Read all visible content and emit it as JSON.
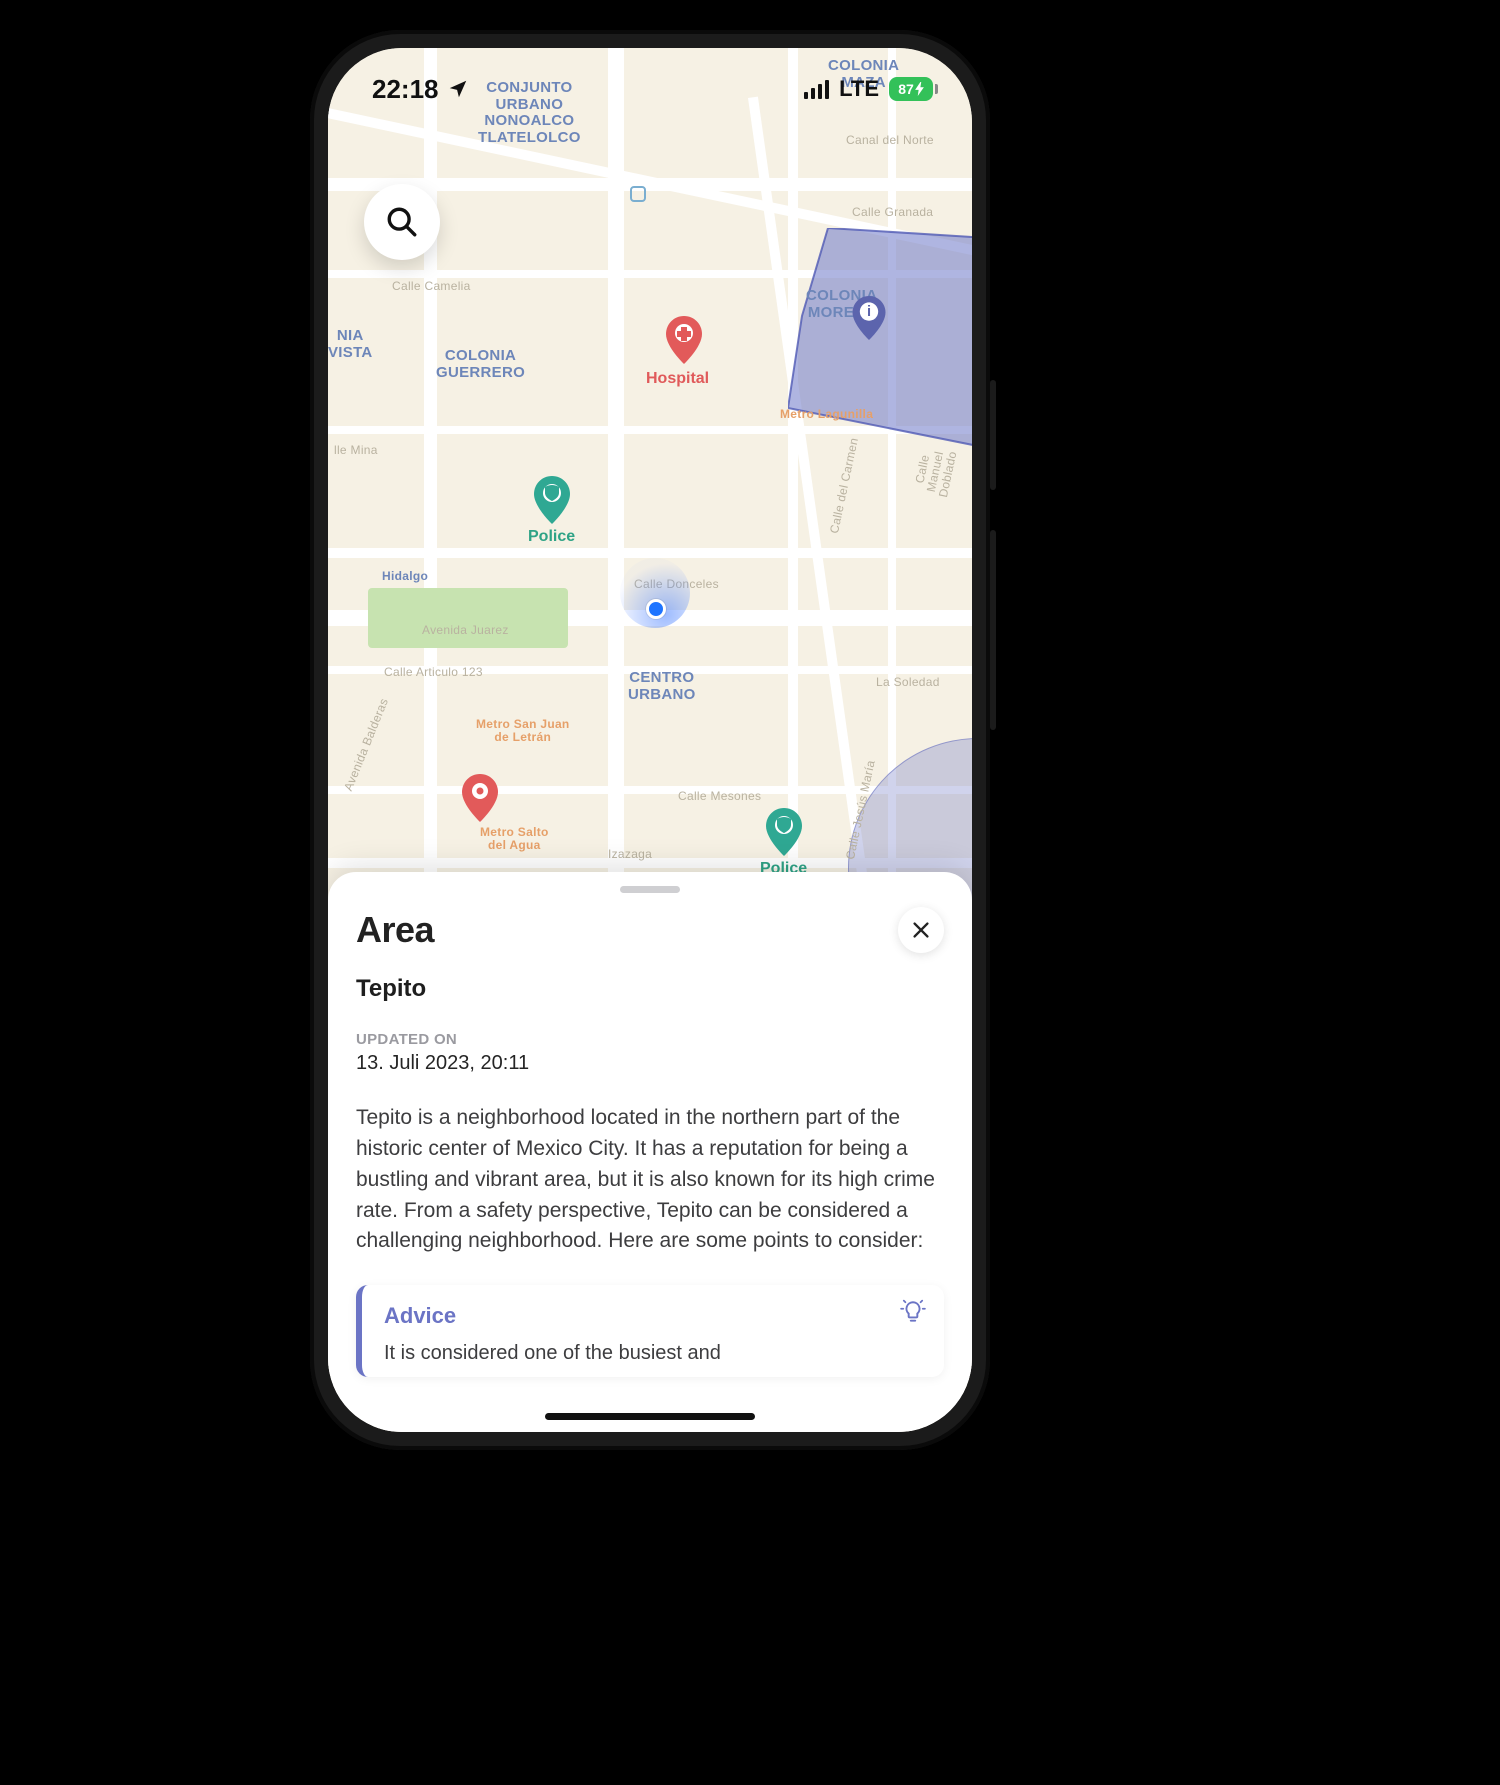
{
  "status": {
    "time": "22:18",
    "network": "LTE",
    "battery": "87"
  },
  "map": {
    "areas": {
      "conjunto": "CONJUNTO\nURBANO\nNONOALCO\nTLATELOLCO",
      "maza": "COLONIA\nMAZA",
      "morelos": "COLONIA\nMORELO",
      "guerrero": "COLONIA\nGUERRERO",
      "vista": "NIA\nVISTA",
      "centro": "CENTRO\nURBANO"
    },
    "streets": {
      "canal": "Canal del Norte",
      "granada": "Calle Granada",
      "camelia": "Calle Camelia",
      "mina": "lle Mina",
      "hidalgo": "Hidalgo",
      "juarez": "Avenida Juarez",
      "articulo": "Calle Articulo 123",
      "donceles": "Calle Donceles",
      "mesones": "Calle Mesones",
      "izazaga": "Izazaga",
      "balderas": "Avenida Balderas",
      "carmen": "Calle del Carmen",
      "jesusmaria": "Calle Jesús María",
      "doblado": "Calle Manuel Doblado",
      "soledad": "La Soledad"
    },
    "metro": {
      "lagunilla": "Metro Lagunilla",
      "sanjuan": "Metro San Juan\nde Letrán",
      "salto": "Metro Salto\ndel Agua"
    },
    "pins": {
      "hospital": "Hospital",
      "police": "Police"
    }
  },
  "sheet": {
    "title": "Area",
    "subtitle": "Tepito",
    "updatedLabel": "UPDATED ON",
    "updatedValue": "13. Juli 2023, 20:11",
    "description": "Tepito is a neighborhood located in the northern part of the historic center of Mexico City. It has a reputation for being a bustling and vibrant area, but it is also known for its high crime rate. From a safety perspective, Tepito can be considered a challenging neighborhood. Here are some points to consider:",
    "adviceTitle": "Advice",
    "adviceText": "It is considered one of the busiest and"
  }
}
